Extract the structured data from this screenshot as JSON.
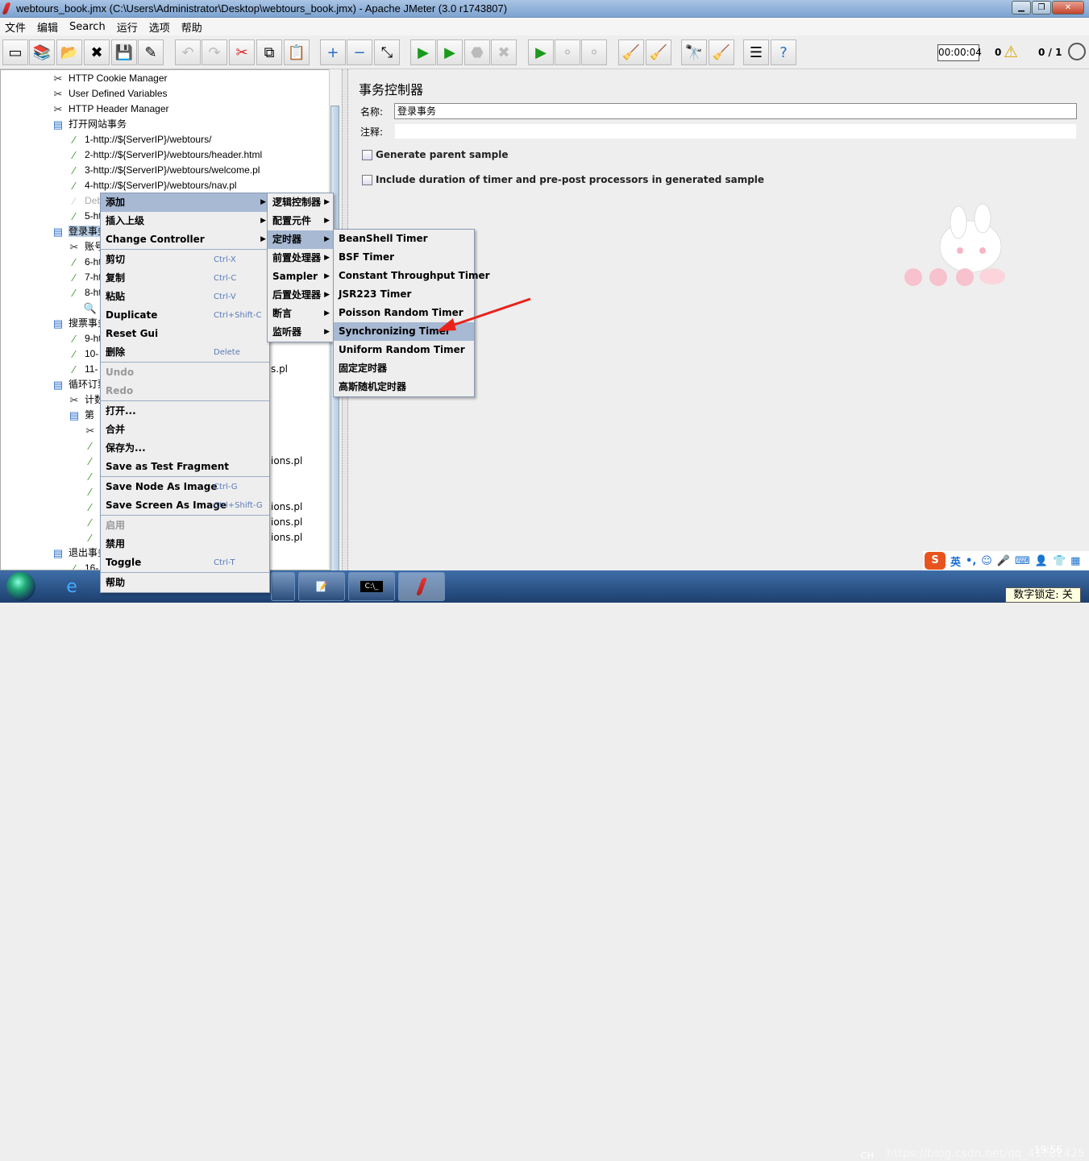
{
  "window": {
    "title": "webtours_book.jmx (C:\\Users\\Administrator\\Desktop\\webtours_book.jmx) - Apache JMeter (3.0 r1743807)",
    "minimize": "▁",
    "restore": "❐",
    "close": "✕"
  },
  "menubar": [
    "文件",
    "编辑",
    "Search",
    "运行",
    "选项",
    "帮助"
  ],
  "toolbar": {
    "buttons": [
      {
        "icon": "new-icon",
        "glyph": "▭"
      },
      {
        "icon": "templates-icon",
        "glyph": "📚"
      },
      {
        "icon": "open-icon",
        "glyph": "📂"
      },
      {
        "icon": "close-icon",
        "glyph": "✖"
      },
      {
        "icon": "save-icon",
        "glyph": "💾"
      },
      {
        "icon": "save-as-icon",
        "glyph": "✎"
      },
      {
        "icon": "undo-icon",
        "glyph": "↶",
        "disabled": true
      },
      {
        "icon": "redo-icon",
        "glyph": "↷",
        "disabled": true
      },
      {
        "icon": "cut-icon",
        "glyph": "✂"
      },
      {
        "icon": "copy-icon",
        "glyph": "⧉"
      },
      {
        "icon": "paste-icon",
        "glyph": "📋"
      },
      {
        "icon": "expand-icon",
        "glyph": "+"
      },
      {
        "icon": "collapse-icon",
        "glyph": "−"
      },
      {
        "icon": "toggle-icon",
        "glyph": "⤡"
      },
      {
        "icon": "start-icon",
        "glyph": "▶"
      },
      {
        "icon": "start-no-timers-icon",
        "glyph": "▶"
      },
      {
        "icon": "stop-icon",
        "glyph": "⬣",
        "disabled": true
      },
      {
        "icon": "shutdown-icon",
        "glyph": "✖",
        "disabled": true
      },
      {
        "icon": "remote-start-icon",
        "glyph": "▶"
      },
      {
        "icon": "remote-stop-icon",
        "glyph": "⚬",
        "disabled": true
      },
      {
        "icon": "remote-shutdown-icon",
        "glyph": "⚬",
        "disabled": true
      },
      {
        "icon": "clear-icon",
        "glyph": "🧹"
      },
      {
        "icon": "clear-all-icon",
        "glyph": "🧹"
      },
      {
        "icon": "search-icon",
        "glyph": "🔭"
      },
      {
        "icon": "reset-search-icon",
        "glyph": "🧹"
      },
      {
        "icon": "function-helper-icon",
        "glyph": "☰"
      },
      {
        "icon": "help-icon",
        "glyph": "?"
      }
    ],
    "elapsed": "00:00:04",
    "warnings": "0",
    "warning_icon": "⚠",
    "threads": "0 / 1"
  },
  "tree": [
    {
      "label": "HTTP Cookie Manager",
      "icon": "config-icon"
    },
    {
      "label": "User Defined Variables",
      "icon": "config-icon"
    },
    {
      "label": "HTTP Header Manager",
      "icon": "config-icon"
    },
    {
      "label": "打开网站事务",
      "icon": "controller-icon"
    },
    {
      "label": "1-http://${ServerIP}/webtours/",
      "icon": "sampler-icon"
    },
    {
      "label": "2-http://${ServerIP}/webtours/header.html",
      "icon": "sampler-icon"
    },
    {
      "label": "3-http://${ServerIP}/webtours/welcome.pl",
      "icon": "sampler-icon"
    },
    {
      "label": "4-http://${ServerIP}/webtours/nav.pl",
      "icon": "sampler-icon"
    },
    {
      "label": "Deb",
      "icon": "sampler-icon",
      "disabled": true
    },
    {
      "label": "5-ht",
      "icon": "sampler-icon"
    },
    {
      "label": "登录事务",
      "icon": "controller-icon",
      "selected": true
    },
    {
      "label": "账号",
      "icon": "config-icon"
    },
    {
      "label": "6-ht",
      "icon": "sampler-icon"
    },
    {
      "label": "7-ht",
      "icon": "sampler-icon"
    },
    {
      "label": "8-ht",
      "icon": "sampler-icon"
    },
    {
      "label": "",
      "icon": "listener-icon"
    },
    {
      "label": "搜票事务",
      "icon": "controller-icon"
    },
    {
      "label": "9-ht",
      "icon": "sampler-icon"
    },
    {
      "label": "10-",
      "icon": "sampler-icon"
    },
    {
      "label": "11-",
      "icon": "sampler-icon",
      "tail": "s.pl"
    },
    {
      "label": "循环订票",
      "icon": "controller-icon"
    },
    {
      "label": "计数",
      "icon": "config-icon"
    },
    {
      "label": "第",
      "icon": "controller-icon"
    },
    {
      "label": "",
      "icon": "config-icon"
    },
    {
      "label": "",
      "icon": "sampler-icon"
    },
    {
      "label": "",
      "icon": "sampler-icon",
      "tail": "ions.pl"
    },
    {
      "label": "",
      "icon": "sampler-icon"
    },
    {
      "label": "",
      "icon": "sampler-icon"
    },
    {
      "label": "",
      "icon": "sampler-icon",
      "tail": "ions.pl"
    },
    {
      "label": "",
      "icon": "sampler-icon",
      "tail": "ions.pl"
    },
    {
      "label": "",
      "icon": "sampler-icon",
      "tail": "ions.pl"
    },
    {
      "label": "退出事务",
      "icon": "controller-icon"
    },
    {
      "label": "16-",
      "icon": "sampler-icon"
    }
  ],
  "context_menu": {
    "groups": [
      [
        {
          "label": "添加",
          "submenu": true,
          "highlighted": true
        },
        {
          "label": "插入上级",
          "submenu": true
        },
        {
          "label": "Change Controller",
          "submenu": true
        }
      ],
      [
        {
          "label": "剪切",
          "shortcut": "Ctrl-X"
        },
        {
          "label": "复制",
          "shortcut": "Ctrl-C"
        },
        {
          "label": "粘贴",
          "shortcut": "Ctrl-V"
        },
        {
          "label": "Duplicate",
          "shortcut": "Ctrl+Shift-C"
        },
        {
          "label": "Reset Gui"
        },
        {
          "label": "删除",
          "shortcut": "Delete"
        }
      ],
      [
        {
          "label": "Undo",
          "disabled": true
        },
        {
          "label": "Redo",
          "disabled": true
        }
      ],
      [
        {
          "label": "打开..."
        },
        {
          "label": "合并"
        },
        {
          "label": "保存为..."
        },
        {
          "label": "Save as Test Fragment"
        }
      ],
      [
        {
          "label": "Save Node As Image",
          "shortcut": "Ctrl-G"
        },
        {
          "label": "Save Screen As Image",
          "shortcut": "Ctrl+Shift-G"
        }
      ],
      [
        {
          "label": "启用",
          "disabled": true
        },
        {
          "label": "禁用"
        },
        {
          "label": "Toggle",
          "shortcut": "Ctrl-T"
        }
      ],
      [
        {
          "label": "帮助"
        }
      ]
    ]
  },
  "add_submenu": [
    {
      "label": "逻辑控制器"
    },
    {
      "label": "配置元件"
    },
    {
      "label": "定时器",
      "highlighted": true
    },
    {
      "label": "前置处理器"
    },
    {
      "label": "Sampler"
    },
    {
      "label": "后置处理器"
    },
    {
      "label": "断言"
    },
    {
      "label": "监听器"
    }
  ],
  "timer_submenu": [
    {
      "label": "BeanShell Timer"
    },
    {
      "label": "BSF Timer"
    },
    {
      "label": "Constant Throughput Timer"
    },
    {
      "label": "JSR223 Timer"
    },
    {
      "label": "Poisson Random Timer"
    },
    {
      "label": "Synchronizing Timer",
      "highlighted": true
    },
    {
      "label": "Uniform Random Timer"
    },
    {
      "label": "固定定时器"
    },
    {
      "label": "高斯随机定时器"
    }
  ],
  "panel": {
    "title": "事务控制器",
    "name_label": "名称:",
    "name_value": "登录事务",
    "comment_label": "注释:",
    "comment_value": "",
    "generate_parent": {
      "label": "Generate parent sample",
      "checked": false
    },
    "include_timers": {
      "label": "Include duration of timer and pre-post processors in generated sample",
      "checked": false
    }
  },
  "annotation_color": "#e8231c",
  "ime": {
    "logo": "S",
    "mode": "英",
    "punct": "•,"
  },
  "taskbar": {
    "lang": "CH",
    "clock": "19:56",
    "numlock_tooltip": "数字锁定: 关",
    "watermark": "https://blog.csdn.net/qq_41782425"
  }
}
